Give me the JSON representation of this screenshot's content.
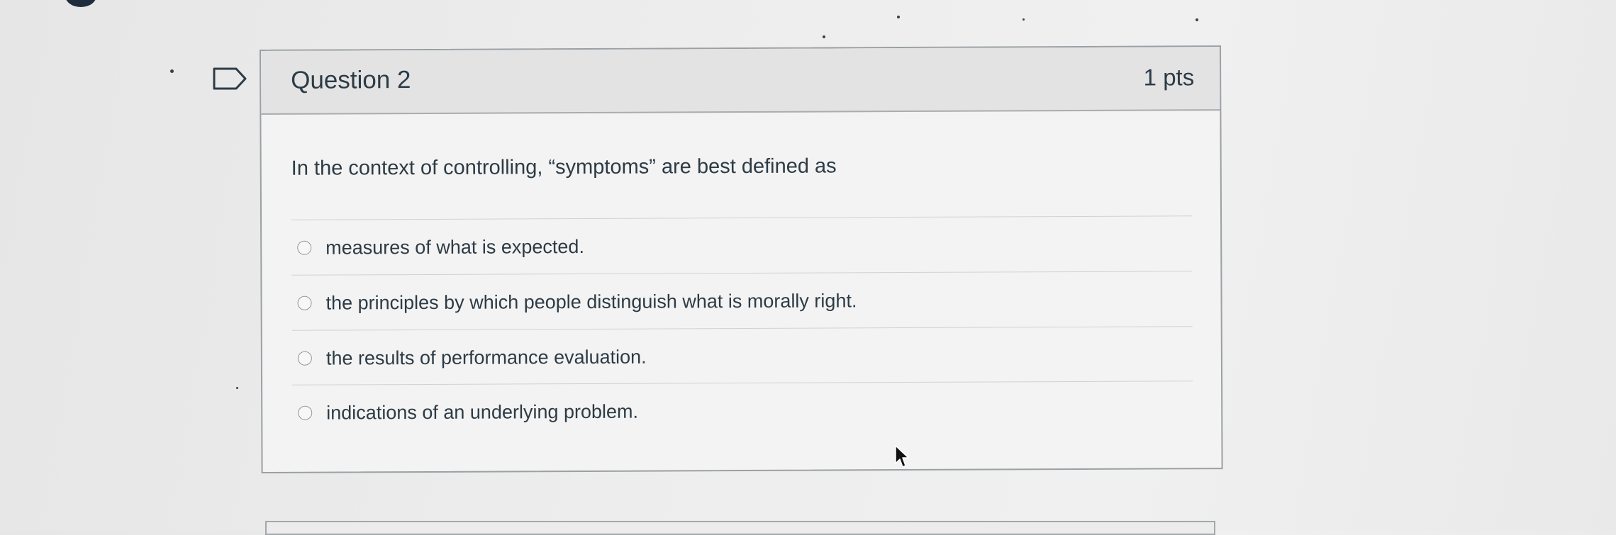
{
  "question": {
    "title": "Question 2",
    "points": "1 pts",
    "prompt": "In the context of controlling, “symptoms” are best defined as",
    "answers": [
      {
        "label": "measures of what is expected."
      },
      {
        "label": "the principles by which people distinguish what is morally right."
      },
      {
        "label": "the results of performance evaluation."
      },
      {
        "label": "indications of an underlying problem."
      }
    ],
    "flag_icon": "flag-outline-icon"
  },
  "colors": {
    "text": "#2d3b45",
    "header_bg": "#e3e3e4",
    "card_border": "#9aa0a4",
    "radio_border": "#8f979d"
  }
}
